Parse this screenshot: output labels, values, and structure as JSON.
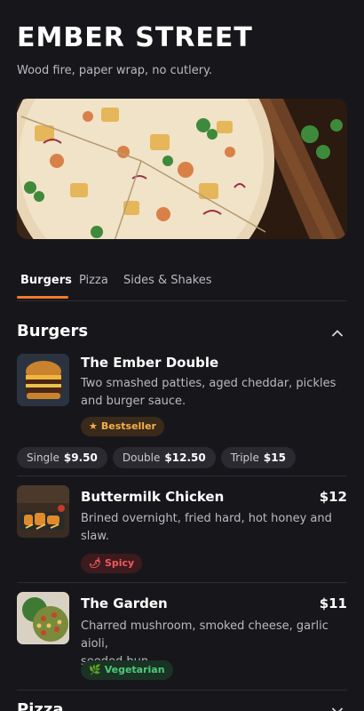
{
  "header": {
    "title": "EMBER STREET",
    "tagline": "Wood fire, paper wrap, no cutlery."
  },
  "hero": {
    "image": "pizza-hero-image"
  },
  "tabs": [
    {
      "label": "Burgers",
      "active": true
    },
    {
      "label": "Pizza",
      "active": false
    },
    {
      "label": "Sides & Shakes",
      "active": false
    }
  ],
  "sections": [
    {
      "title": "Burgers",
      "expanded": true,
      "items": [
        {
          "name": "The Ember Double",
          "desc_line1": "Two smashed patties, aged cheddar, pickles",
          "desc_line2": "and burger sauce.",
          "badge": {
            "label": "Bestseller",
            "icon": "star-icon"
          },
          "variants": [
            {
              "label": "Single",
              "price": "$9.50"
            },
            {
              "label": "Double",
              "price": "$12.50"
            },
            {
              "label": "Triple",
              "price": "$15"
            }
          ]
        },
        {
          "name": "Buttermilk Chicken",
          "price": "$12",
          "desc_line1": "Brined overnight, fried hard, hot honey and",
          "desc_line2": "slaw.",
          "badge": {
            "label": "Spicy",
            "icon": "chili-icon"
          }
        },
        {
          "name": "The Garden",
          "price": "$11",
          "desc_line1": "Charred mushroom, smoked cheese, garlic aioli,",
          "desc_line2": "seeded bun.",
          "badge": {
            "label": "Vegetarian",
            "icon": "leaf-icon"
          }
        }
      ]
    },
    {
      "title": "Pizza",
      "expanded": false
    }
  ],
  "colors": {
    "accent": "#f07a2a",
    "background": "#17171b",
    "bestseller": "#f3b04d",
    "spicy": "#ef5a5a",
    "vegetarian": "#4cc97a"
  }
}
